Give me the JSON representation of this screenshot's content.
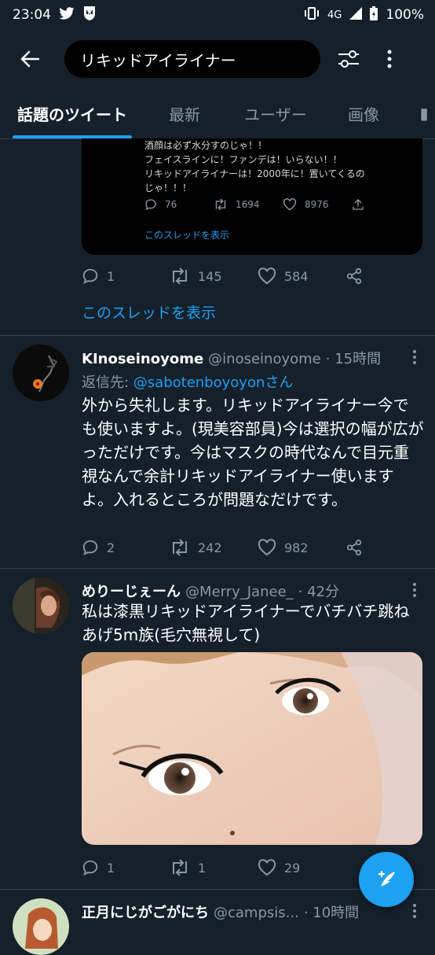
{
  "status_bar": {
    "time": "23:04",
    "network": "4G",
    "battery": "100%"
  },
  "search": {
    "value": "リキッドアイライナー"
  },
  "tabs": [
    {
      "label": "話題のツイート",
      "active": true
    },
    {
      "label": "最新"
    },
    {
      "label": "ユーザー"
    },
    {
      "label": "画像"
    }
  ],
  "quoted_tweet": {
    "text": "酒顔は必ず水分すのじゃ！！\nフェイスラインに！ファンデは！いらない！！\nリキッドアイライナーは！2000年に！置いてくるの\nじゃ！！！",
    "replies": "76",
    "retweets": "1694",
    "likes": "8976",
    "thread_link": "このスレッドを表示"
  },
  "tweet0": {
    "replies": "1",
    "retweets": "145",
    "likes": "584",
    "thread_link": "このスレッドを表示"
  },
  "tweet1": {
    "name": "KInoseinoyome",
    "handle": "@inoseinoyome",
    "time": "· 15時間",
    "reply_prefix": "返信先: ",
    "reply_to": "@sabotenboyoyonさん",
    "text": "外から失礼します。リキッドアイライナー今でも使いますよ。(現美容部員)今は選択の幅が広がっただけです。今はマスクの時代なんで目元重視なんで余計リキッドアイライナー使いますよ。入れるところが問題なだけです。",
    "replies": "2",
    "retweets": "242",
    "likes": "982"
  },
  "tweet2": {
    "name": "めりーじぇーん",
    "handle": "@Merry_Janee_",
    "time": "· 42分",
    "text": "私は漆黒リキッドアイライナーでバチバチ跳ねあげ5m族(毛穴無視して)",
    "replies": "1",
    "retweets": "1",
    "likes": "29"
  },
  "tweet3": {
    "name": "正月にじがごがにち",
    "handle": "@campsis...",
    "time": "· 10時間"
  },
  "colors": {
    "background": "#15202b",
    "accent": "#1da1f2",
    "muted": "#8899a6",
    "separator": "#38444d"
  }
}
